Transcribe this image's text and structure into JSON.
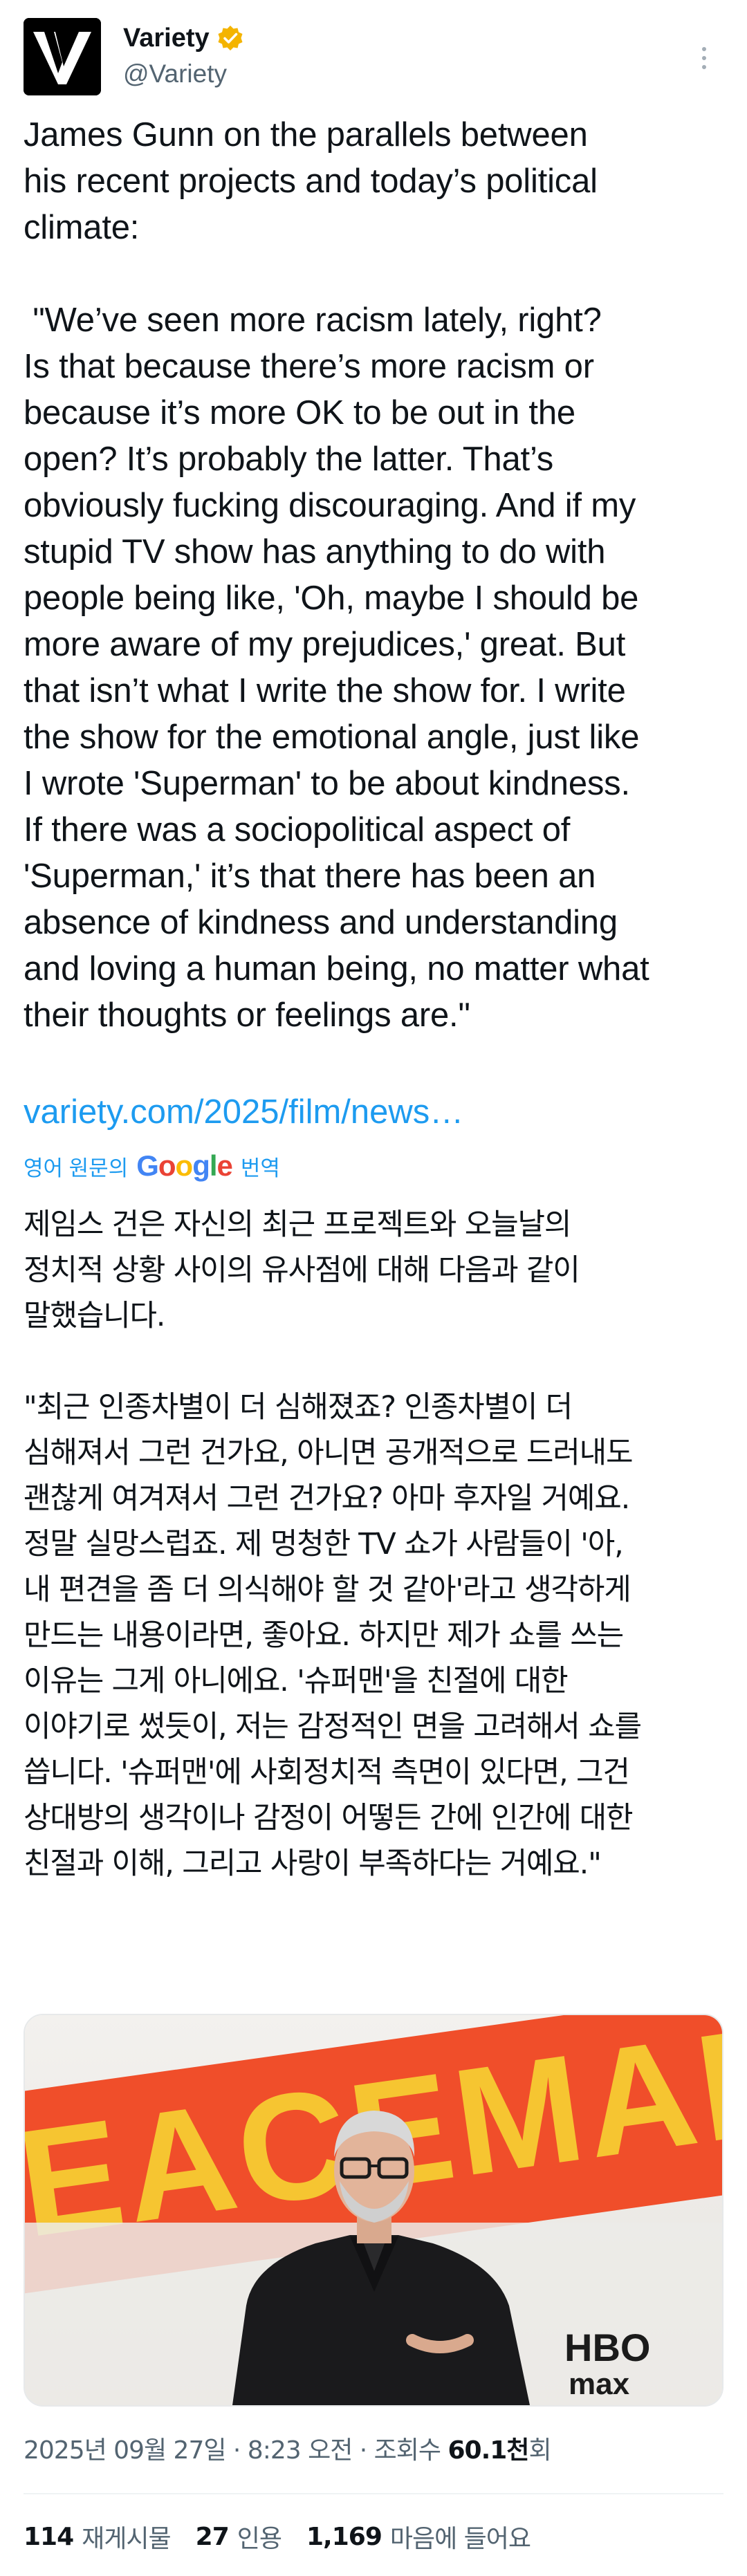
{
  "account": {
    "display_name": "Variety",
    "handle": "@Variety",
    "verified_badge_icon": "verified-badge-icon",
    "badge_color": "#f4b400",
    "logo_letter": "V"
  },
  "post": {
    "text": "James Gunn on the parallels between\nhis recent projects and today’s political\nclimate:\n\n \"We’ve seen more racism lately, right?\nIs that because there’s more racism or\nbecause it’s more OK to be out in the\nopen? It’s probably the latter. That’s\nobviously fucking discouraging. And if my\nstupid TV show has anything to do with\npeople being like, 'Oh, maybe I should be\nmore aware of my prejudices,' great. But\nthat isn’t what I write the show for. I write\nthe show for the emotional angle, just like\nI wrote 'Superman' to be about kindness.\nIf there was a sociopolitical aspect of\n'Superman,' it’s that there has been an\nabsence of kindness and understanding\nand loving a human being, no matter what\ntheir thoughts or feelings are.\"",
    "link": "variety.com/2025/film/news…",
    "link_color": "#1d9bf0"
  },
  "translation": {
    "prefix": "영어 원문의",
    "google": [
      "G",
      "o",
      "o",
      "g",
      "l",
      "e"
    ],
    "suffix": "번역",
    "text": "제임스 건은 자신의 최근 프로젝트와 오늘날의\n정치적 상황 사이의 유사점에 대해 다음과 같이\n말했습니다.\n\n\"최근 인종차별이 더 심해졌죠? 인종차별이 더\n심해져서 그런 건가요, 아니면 공개적으로 드러내도\n괜찮게 여겨져서 그런 건가요? 아마 후자일 거예요.\n정말 실망스럽죠. 제 멍청한 TV 쇼가 사람들이 '아,\n내 편견을 좀 더 의식해야 할 것 같아'라고 생각하게\n만드는 내용이라면, 좋아요. 하지만 제가 쇼를 쓰는\n이유는 그게 아니에요. '슈퍼맨'을 친절에 대한\n이야기로 썼듯이, 저는 감정적인 면을 고려해서 쇼를\n씁니다. '슈퍼맨'에 사회정치적 측면이 있다면, 그건\n상대방의 생각이나 감정이 어떻든 간에 인간에 대한\n친절과 이해, 그리고 사랑이 부족하다는 거예요.\""
  },
  "photo": {
    "backdrop_letters": "EACEMAKE",
    "backdrop_color": "#f04e2a",
    "letter_color": "#f6c531",
    "logo_text": "HBO",
    "logo_subtext": "max"
  },
  "meta": {
    "timestamp": "2025년 09월 27일 · 8:23 오전 · 조회수 ",
    "views": "60.1천",
    "views_suffix": "회"
  },
  "stats": [
    {
      "num": "114",
      "label": "재게시물"
    },
    {
      "num": "27",
      "label": "인용"
    },
    {
      "num": "1,169",
      "label": "마음에 들어요"
    }
  ]
}
